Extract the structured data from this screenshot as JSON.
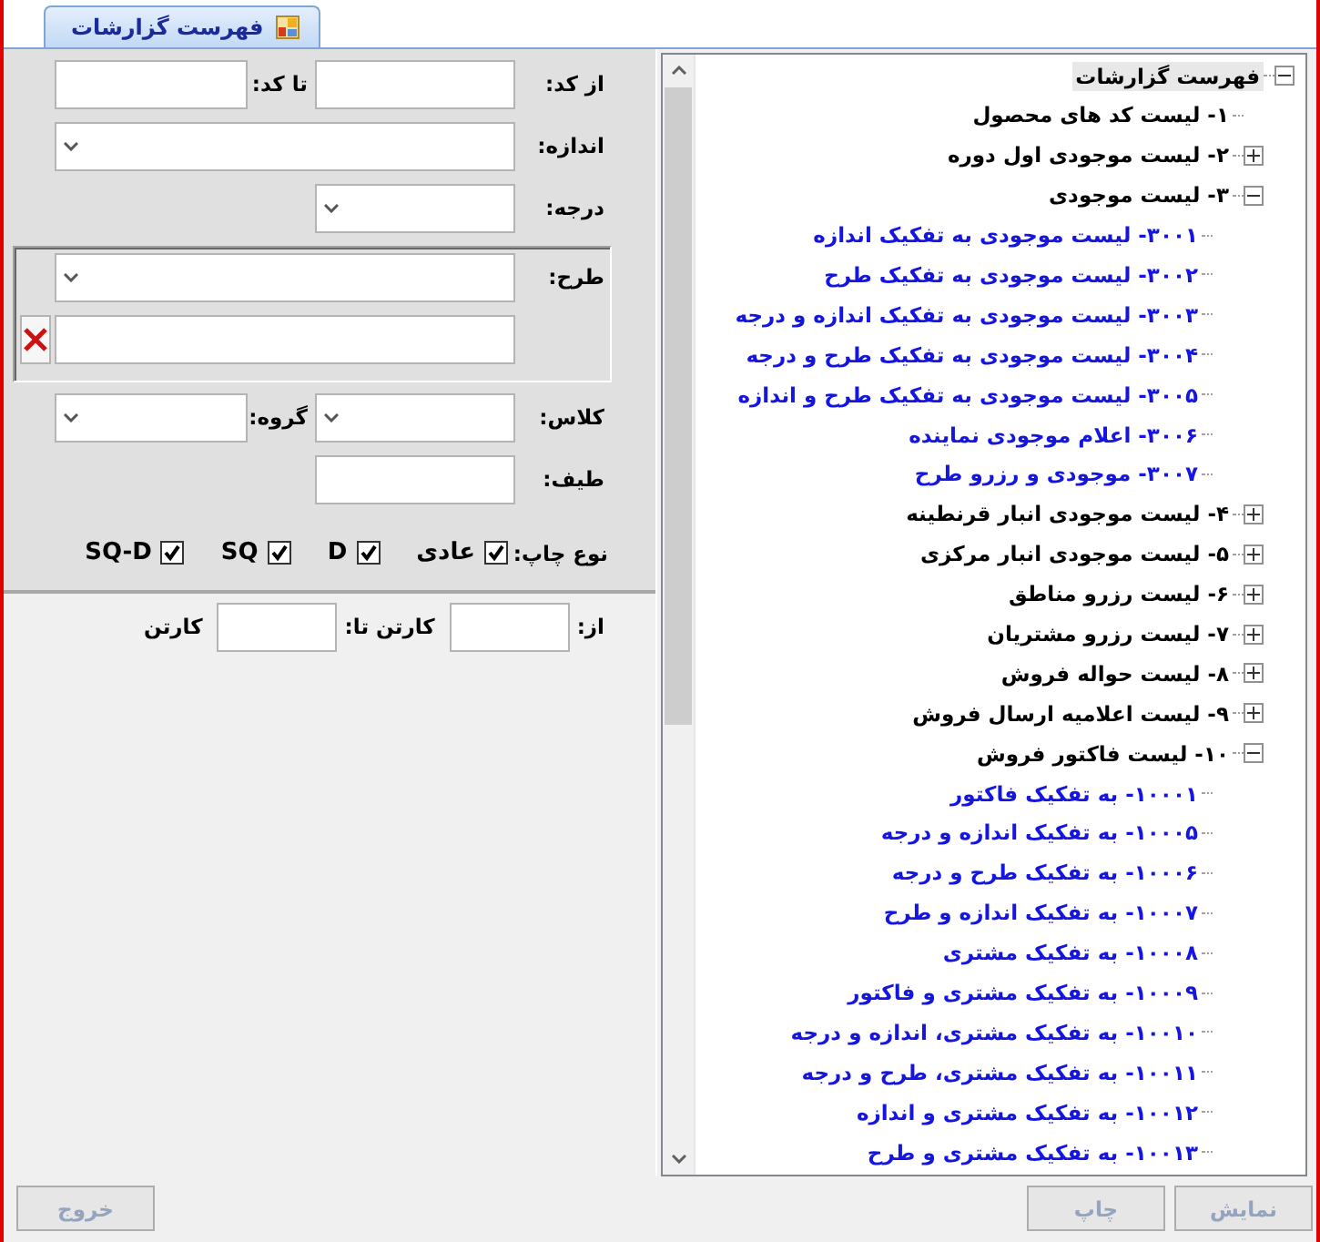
{
  "tab": {
    "label": "فهرست گزارشات",
    "selected": true
  },
  "form": {
    "blocks": [
      {
        "kind": "plain",
        "rows": [
          {
            "kind": "grid",
            "items": [
              {
                "kind": "label",
                "text": "از کد:"
              },
              {
                "kind": "text"
              },
              {
                "kind": "label",
                "text": "تا کد:"
              },
              {
                "kind": "text"
              }
            ]
          },
          {
            "kind": "grid",
            "items": [
              {
                "kind": "label",
                "text": "اندازه:"
              },
              {
                "kind": "wide_dropdown"
              }
            ]
          },
          {
            "kind": "grid",
            "items": [
              {
                "kind": "label",
                "text": "درجه:"
              },
              {
                "kind": "dropdown"
              }
            ]
          }
        ]
      },
      {
        "kind": "group",
        "rows": [
          {
            "kind": "grid",
            "items": [
              {
                "kind": "label",
                "text": "طرح:"
              },
              {
                "kind": "wide_dropdown"
              }
            ]
          },
          {
            "kind": "grid",
            "items": [
              {
                "kind": "spacer"
              },
              {
                "kind": "wide_text"
              },
              {
                "kind": "clear_button"
              }
            ]
          }
        ]
      },
      {
        "kind": "plain",
        "rows": [
          {
            "kind": "grid",
            "items": [
              {
                "kind": "label",
                "text": "کلاس:"
              },
              {
                "kind": "dropdown"
              },
              {
                "kind": "label",
                "text": "گروه:"
              },
              {
                "kind": "dropdown"
              }
            ]
          },
          {
            "kind": "grid",
            "items": [
              {
                "kind": "label",
                "text": "طیف:"
              },
              {
                "kind": "text"
              }
            ]
          },
          {
            "kind": "checks",
            "items": [
              {
                "kind": "label",
                "text": "نوع چاپ:"
              },
              {
                "kind": "checkbox",
                "label": "عادی",
                "checked": true
              },
              {
                "kind": "checkbox",
                "label": "D",
                "checked": true
              },
              {
                "kind": "checkbox",
                "label": "SQ",
                "checked": true
              },
              {
                "kind": "checkbox",
                "label": "SQ-D",
                "checked": true
              }
            ]
          }
        ]
      },
      {
        "kind": "lower",
        "rows": [
          {
            "kind": "flow",
            "items": [
              {
                "kind": "label",
                "text": "از:"
              },
              {
                "kind": "text"
              },
              {
                "kind": "label",
                "text": "کارتن"
              },
              {
                "kind": "label",
                "text": "تا:"
              },
              {
                "kind": "text"
              },
              {
                "kind": "label",
                "text": "کارتن"
              }
            ]
          }
        ]
      }
    ]
  },
  "tree": {
    "label": "فهرست گزارشات",
    "selected": true,
    "expanded": true,
    "children": [
      {
        "label": "۱- لیست کد های محصول",
        "selected": false
      },
      {
        "label": "۲- لیست موجودی اول دوره",
        "selected": false,
        "expanded": false
      },
      {
        "label": "۳- لیست موجودی",
        "selected": false,
        "expanded": true,
        "children": [
          {
            "label": "۳۰۰۱- لیست موجودی به تفکیک اندازه",
            "selected": false
          },
          {
            "label": "۳۰۰۲- لیست موجودی به تفکیک طرح",
            "selected": false
          },
          {
            "label": "۳۰۰۳- لیست موجودی به تفکیک اندازه و درجه",
            "selected": false
          },
          {
            "label": "۳۰۰۴- لیست موجودی به تفکیک طرح و درجه",
            "selected": false
          },
          {
            "label": "۳۰۰۵- لیست موجودی به تفکیک طرح و اندازه",
            "selected": false
          },
          {
            "label": "۳۰۰۶- اعلام موجودی نماینده",
            "selected": false
          },
          {
            "label": "۳۰۰۷- موجودی و رزرو طرح",
            "selected": false
          }
        ]
      },
      {
        "label": "۴- لیست موجودی انبار قرنطینه",
        "selected": false,
        "expanded": false
      },
      {
        "label": "۵- لیست موجودی انبار مرکزی",
        "selected": false,
        "expanded": false
      },
      {
        "label": "۶- لیست رزرو مناطق",
        "selected": false,
        "expanded": false
      },
      {
        "label": "۷- لیست رزرو مشتریان",
        "selected": false,
        "expanded": false
      },
      {
        "label": "۸- لیست حواله فروش",
        "selected": false,
        "expanded": false
      },
      {
        "label": "۹- لیست اعلامیه ارسال فروش",
        "selected": false,
        "expanded": false
      },
      {
        "label": "۱۰- لیست فاکتور فروش",
        "selected": false,
        "expanded": true,
        "children": [
          {
            "label": "۱۰۰۰۱- به تفکیک فاکتور",
            "selected": false
          },
          {
            "label": "۱۰۰۰۵- به تفکیک اندازه و درجه",
            "selected": false
          },
          {
            "label": "۱۰۰۰۶- به تفکیک طرح و درجه",
            "selected": false
          },
          {
            "label": "۱۰۰۰۷- به تفکیک اندازه و طرح",
            "selected": false
          },
          {
            "label": "۱۰۰۰۸- به تفکیک مشتری",
            "selected": false
          },
          {
            "label": "۱۰۰۰۹- به تفکیک مشتری و فاکتور",
            "selected": false
          },
          {
            "label": "۱۰۰۱۰- به تفکیک مشتری، اندازه و درجه",
            "selected": false
          },
          {
            "label": "۱۰۰۱۱- به تفکیک مشتری، طرح و درجه",
            "selected": false
          },
          {
            "label": "۱۰۰۱۲- به تفکیک مشتری و اندازه",
            "selected": false
          },
          {
            "label": "۱۰۰۱۳- به تفکیک مشتری و طرح",
            "selected": false
          }
        ]
      }
    ]
  },
  "buttons": [
    {
      "kind": "right",
      "label": "نمایش",
      "disabled": true
    },
    {
      "kind": "right",
      "label": "چاپ",
      "disabled": true
    },
    {
      "kind": "left",
      "label": "خروج",
      "disabled": true
    }
  ]
}
